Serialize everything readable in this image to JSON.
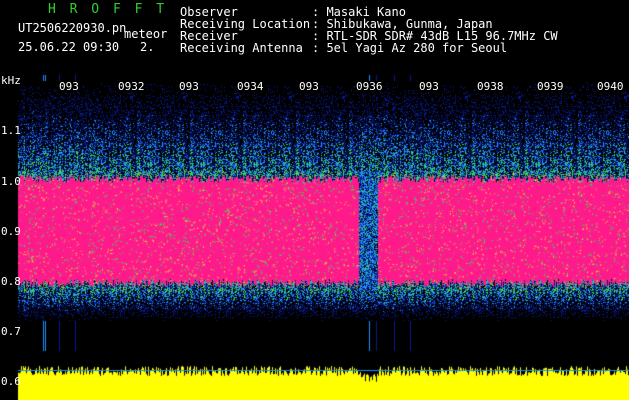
{
  "header": {
    "title": "H R O F F T",
    "filename": "UT2506220930.pn",
    "mode": "meteor",
    "datetime": "25.06.22 09:30",
    "index": "2.",
    "fields": [
      {
        "label": "Observer",
        "value": ": Masaki Kano"
      },
      {
        "label": "Receiving Location",
        "value": ": Shibukawa, Gunma, Japan"
      },
      {
        "label": "Receiver",
        "value": ": RTL-SDR SDR# 43dB L15 96.7MHz CW"
      },
      {
        "label": "Receiving Antenna",
        "value": ": 5el Yagi Az 280 for Seoul"
      }
    ]
  },
  "axis": {
    "y_unit": "kHz",
    "y_ticks": [
      "1.1",
      "1.0",
      "0.9",
      "0.8",
      "0.7",
      "0.6"
    ],
    "x_ticks": [
      "093",
      "0932",
      "093",
      "0934",
      "093",
      "0936",
      "093",
      "0938",
      "0939",
      "0940"
    ]
  },
  "colors": {
    "signal_core": "#ff1a8c",
    "noise_low": "#0a1a8c",
    "noise_mid": "#1e8cff",
    "noise_high": "#33dd55",
    "amplitude": "#ffff00",
    "title": "#33cc33"
  },
  "spectrogram": {
    "band_khz": [
      0.78,
      1.02
    ],
    "noise_khz": [
      0.72,
      1.2
    ],
    "quiet_segment_fraction": [
      0.57,
      0.6
    ]
  }
}
